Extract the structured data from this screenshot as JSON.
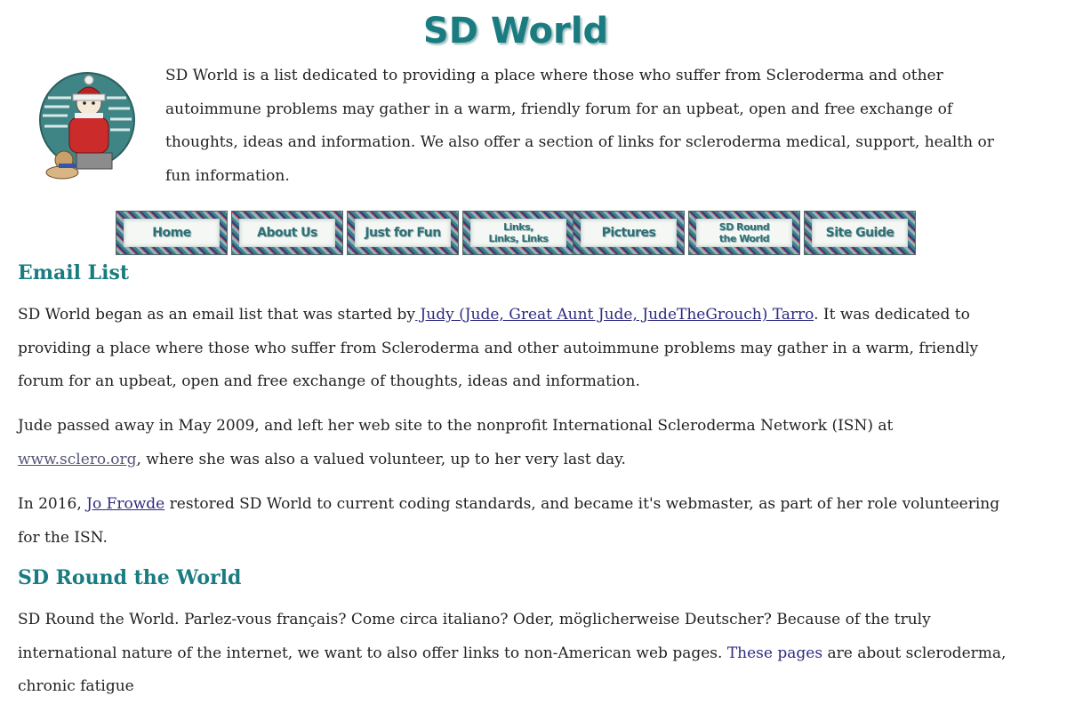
{
  "header": {
    "title": "SD World",
    "intro": "SD World is a list dedicated to providing a place where those who suffer from Scleroderma and other autoimmune problems may gather in a warm, friendly forum for an upbeat, open and free exchange of thoughts, ideas and information. We also offer a section of links for scleroderma medical, support, health or fun information."
  },
  "nav": [
    {
      "label": "Home"
    },
    {
      "label": "About Us"
    },
    {
      "label": "Just for Fun"
    },
    {
      "label": "Links,\nLinks, Links"
    },
    {
      "label": "Pictures"
    },
    {
      "label": "SD Round\nthe World"
    },
    {
      "label": "Site Guide"
    }
  ],
  "email_list": {
    "heading": "Email List",
    "p1_before": "SD World began as an email list that was started by",
    "p1_link": " Judy (Jude, Great Aunt Jude, JudeTheGrouch) Tarro",
    "p1_after": ". It was dedicated to providing a place where those who suffer from Scleroderma and other autoimmune problems may gather in a warm, friendly forum for an upbeat, open and free exchange of thoughts, ideas and information.",
    "p2_before": "Jude passed away in May 2009, and left her web site to the nonprofit International Scleroderma Network (ISN) at ",
    "p2_link": "www.sclero.org",
    "p2_after": ", where she was also a valued volunteer, up to her very last day.",
    "p3_before": "In 2016, ",
    "p3_link": "Jo Frowde",
    "p3_after": " restored SD World to current coding standards, and became it's webmaster, as part of her role volunteering for the ISN."
  },
  "round_world": {
    "heading": "SD Round the World",
    "p1_before": "SD Round the World. Parlez-vous français? Come circa italiano? Oder, möglicherweise Deutscher? Because of the truly international nature of the internet, we want to also offer links to non-American web pages. ",
    "p1_link": "These pages",
    "p1_after": " are about scleroderma, chronic fatigue"
  }
}
